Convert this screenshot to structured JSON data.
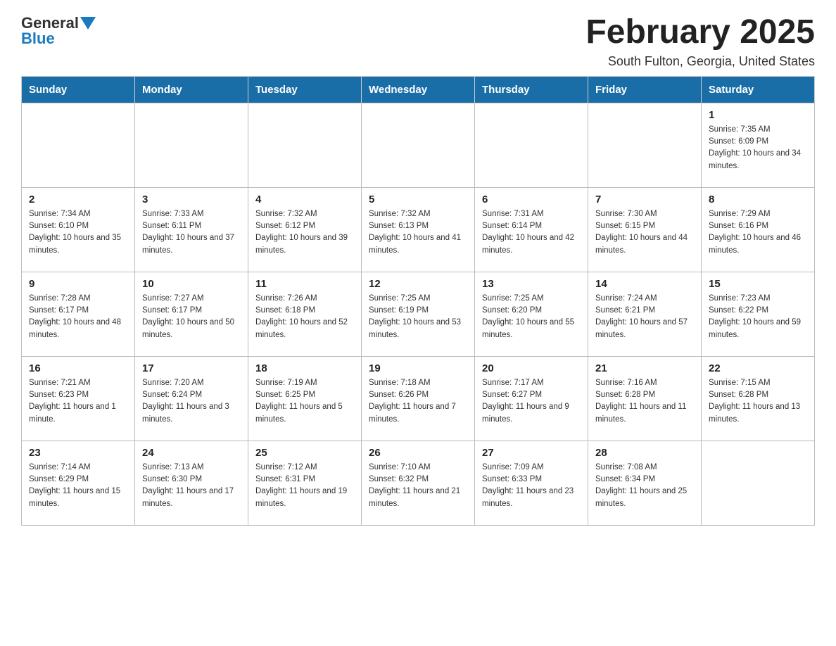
{
  "logo": {
    "text_general": "General",
    "text_blue": "Blue"
  },
  "title": "February 2025",
  "subtitle": "South Fulton, Georgia, United States",
  "days_header": [
    "Sunday",
    "Monday",
    "Tuesday",
    "Wednesday",
    "Thursday",
    "Friday",
    "Saturday"
  ],
  "weeks": [
    [
      {
        "day": "",
        "sunrise": "",
        "sunset": "",
        "daylight": ""
      },
      {
        "day": "",
        "sunrise": "",
        "sunset": "",
        "daylight": ""
      },
      {
        "day": "",
        "sunrise": "",
        "sunset": "",
        "daylight": ""
      },
      {
        "day": "",
        "sunrise": "",
        "sunset": "",
        "daylight": ""
      },
      {
        "day": "",
        "sunrise": "",
        "sunset": "",
        "daylight": ""
      },
      {
        "day": "",
        "sunrise": "",
        "sunset": "",
        "daylight": ""
      },
      {
        "day": "1",
        "sunrise": "Sunrise: 7:35 AM",
        "sunset": "Sunset: 6:09 PM",
        "daylight": "Daylight: 10 hours and 34 minutes."
      }
    ],
    [
      {
        "day": "2",
        "sunrise": "Sunrise: 7:34 AM",
        "sunset": "Sunset: 6:10 PM",
        "daylight": "Daylight: 10 hours and 35 minutes."
      },
      {
        "day": "3",
        "sunrise": "Sunrise: 7:33 AM",
        "sunset": "Sunset: 6:11 PM",
        "daylight": "Daylight: 10 hours and 37 minutes."
      },
      {
        "day": "4",
        "sunrise": "Sunrise: 7:32 AM",
        "sunset": "Sunset: 6:12 PM",
        "daylight": "Daylight: 10 hours and 39 minutes."
      },
      {
        "day": "5",
        "sunrise": "Sunrise: 7:32 AM",
        "sunset": "Sunset: 6:13 PM",
        "daylight": "Daylight: 10 hours and 41 minutes."
      },
      {
        "day": "6",
        "sunrise": "Sunrise: 7:31 AM",
        "sunset": "Sunset: 6:14 PM",
        "daylight": "Daylight: 10 hours and 42 minutes."
      },
      {
        "day": "7",
        "sunrise": "Sunrise: 7:30 AM",
        "sunset": "Sunset: 6:15 PM",
        "daylight": "Daylight: 10 hours and 44 minutes."
      },
      {
        "day": "8",
        "sunrise": "Sunrise: 7:29 AM",
        "sunset": "Sunset: 6:16 PM",
        "daylight": "Daylight: 10 hours and 46 minutes."
      }
    ],
    [
      {
        "day": "9",
        "sunrise": "Sunrise: 7:28 AM",
        "sunset": "Sunset: 6:17 PM",
        "daylight": "Daylight: 10 hours and 48 minutes."
      },
      {
        "day": "10",
        "sunrise": "Sunrise: 7:27 AM",
        "sunset": "Sunset: 6:17 PM",
        "daylight": "Daylight: 10 hours and 50 minutes."
      },
      {
        "day": "11",
        "sunrise": "Sunrise: 7:26 AM",
        "sunset": "Sunset: 6:18 PM",
        "daylight": "Daylight: 10 hours and 52 minutes."
      },
      {
        "day": "12",
        "sunrise": "Sunrise: 7:25 AM",
        "sunset": "Sunset: 6:19 PM",
        "daylight": "Daylight: 10 hours and 53 minutes."
      },
      {
        "day": "13",
        "sunrise": "Sunrise: 7:25 AM",
        "sunset": "Sunset: 6:20 PM",
        "daylight": "Daylight: 10 hours and 55 minutes."
      },
      {
        "day": "14",
        "sunrise": "Sunrise: 7:24 AM",
        "sunset": "Sunset: 6:21 PM",
        "daylight": "Daylight: 10 hours and 57 minutes."
      },
      {
        "day": "15",
        "sunrise": "Sunrise: 7:23 AM",
        "sunset": "Sunset: 6:22 PM",
        "daylight": "Daylight: 10 hours and 59 minutes."
      }
    ],
    [
      {
        "day": "16",
        "sunrise": "Sunrise: 7:21 AM",
        "sunset": "Sunset: 6:23 PM",
        "daylight": "Daylight: 11 hours and 1 minute."
      },
      {
        "day": "17",
        "sunrise": "Sunrise: 7:20 AM",
        "sunset": "Sunset: 6:24 PM",
        "daylight": "Daylight: 11 hours and 3 minutes."
      },
      {
        "day": "18",
        "sunrise": "Sunrise: 7:19 AM",
        "sunset": "Sunset: 6:25 PM",
        "daylight": "Daylight: 11 hours and 5 minutes."
      },
      {
        "day": "19",
        "sunrise": "Sunrise: 7:18 AM",
        "sunset": "Sunset: 6:26 PM",
        "daylight": "Daylight: 11 hours and 7 minutes."
      },
      {
        "day": "20",
        "sunrise": "Sunrise: 7:17 AM",
        "sunset": "Sunset: 6:27 PM",
        "daylight": "Daylight: 11 hours and 9 minutes."
      },
      {
        "day": "21",
        "sunrise": "Sunrise: 7:16 AM",
        "sunset": "Sunset: 6:28 PM",
        "daylight": "Daylight: 11 hours and 11 minutes."
      },
      {
        "day": "22",
        "sunrise": "Sunrise: 7:15 AM",
        "sunset": "Sunset: 6:28 PM",
        "daylight": "Daylight: 11 hours and 13 minutes."
      }
    ],
    [
      {
        "day": "23",
        "sunrise": "Sunrise: 7:14 AM",
        "sunset": "Sunset: 6:29 PM",
        "daylight": "Daylight: 11 hours and 15 minutes."
      },
      {
        "day": "24",
        "sunrise": "Sunrise: 7:13 AM",
        "sunset": "Sunset: 6:30 PM",
        "daylight": "Daylight: 11 hours and 17 minutes."
      },
      {
        "day": "25",
        "sunrise": "Sunrise: 7:12 AM",
        "sunset": "Sunset: 6:31 PM",
        "daylight": "Daylight: 11 hours and 19 minutes."
      },
      {
        "day": "26",
        "sunrise": "Sunrise: 7:10 AM",
        "sunset": "Sunset: 6:32 PM",
        "daylight": "Daylight: 11 hours and 21 minutes."
      },
      {
        "day": "27",
        "sunrise": "Sunrise: 7:09 AM",
        "sunset": "Sunset: 6:33 PM",
        "daylight": "Daylight: 11 hours and 23 minutes."
      },
      {
        "day": "28",
        "sunrise": "Sunrise: 7:08 AM",
        "sunset": "Sunset: 6:34 PM",
        "daylight": "Daylight: 11 hours and 25 minutes."
      },
      {
        "day": "",
        "sunrise": "",
        "sunset": "",
        "daylight": ""
      }
    ]
  ]
}
